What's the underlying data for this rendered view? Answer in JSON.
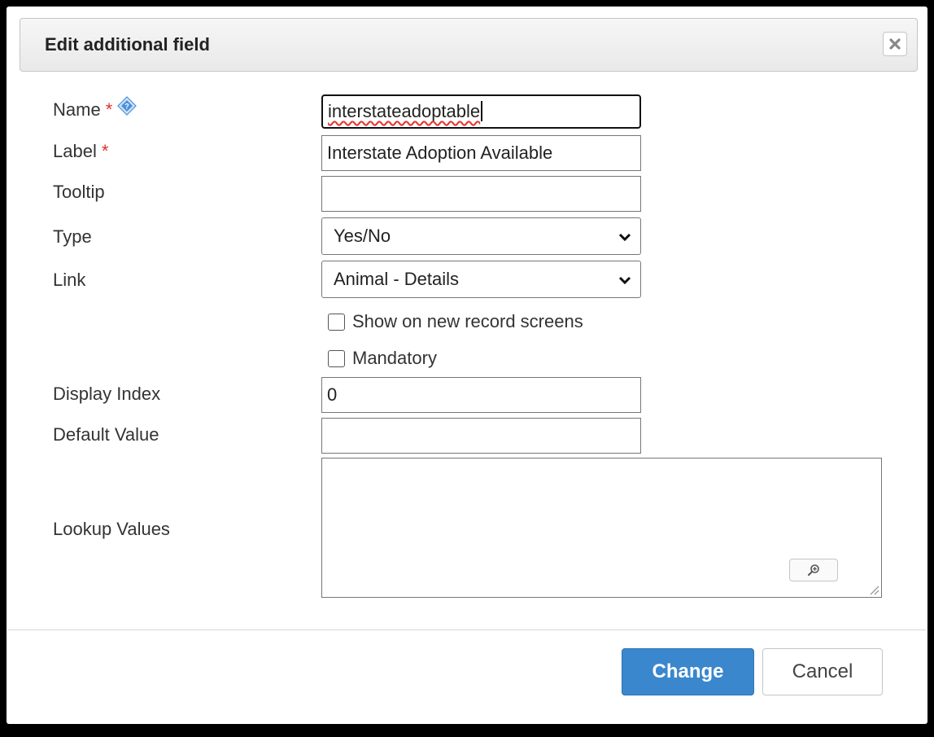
{
  "dialog": {
    "title": "Edit additional field",
    "close_icon": "close-icon"
  },
  "fields": {
    "name": {
      "label": "Name",
      "required_mark": "*",
      "value": "interstateadoptable",
      "help_icon": "help-diamond-icon"
    },
    "label": {
      "label": "Label",
      "required_mark": "*",
      "value": "Interstate Adoption Available"
    },
    "tooltip": {
      "label": "Tooltip",
      "value": ""
    },
    "type": {
      "label": "Type",
      "selected": "Yes/No"
    },
    "link": {
      "label": "Link",
      "selected": "Animal - Details"
    },
    "show_on_new": {
      "label": "Show on new record screens",
      "checked": false
    },
    "mandatory": {
      "label": "Mandatory",
      "checked": false
    },
    "display_index": {
      "label": "Display Index",
      "value": "0"
    },
    "default_value": {
      "label": "Default Value",
      "value": ""
    },
    "lookup_values": {
      "label": "Lookup Values",
      "value": "",
      "zoom_icon": "zoom-icon"
    }
  },
  "buttons": {
    "change": "Change",
    "cancel": "Cancel"
  },
  "colors": {
    "primary": "#3a87cd",
    "required": "#e0302c",
    "help_icon": "#4a90d9"
  }
}
